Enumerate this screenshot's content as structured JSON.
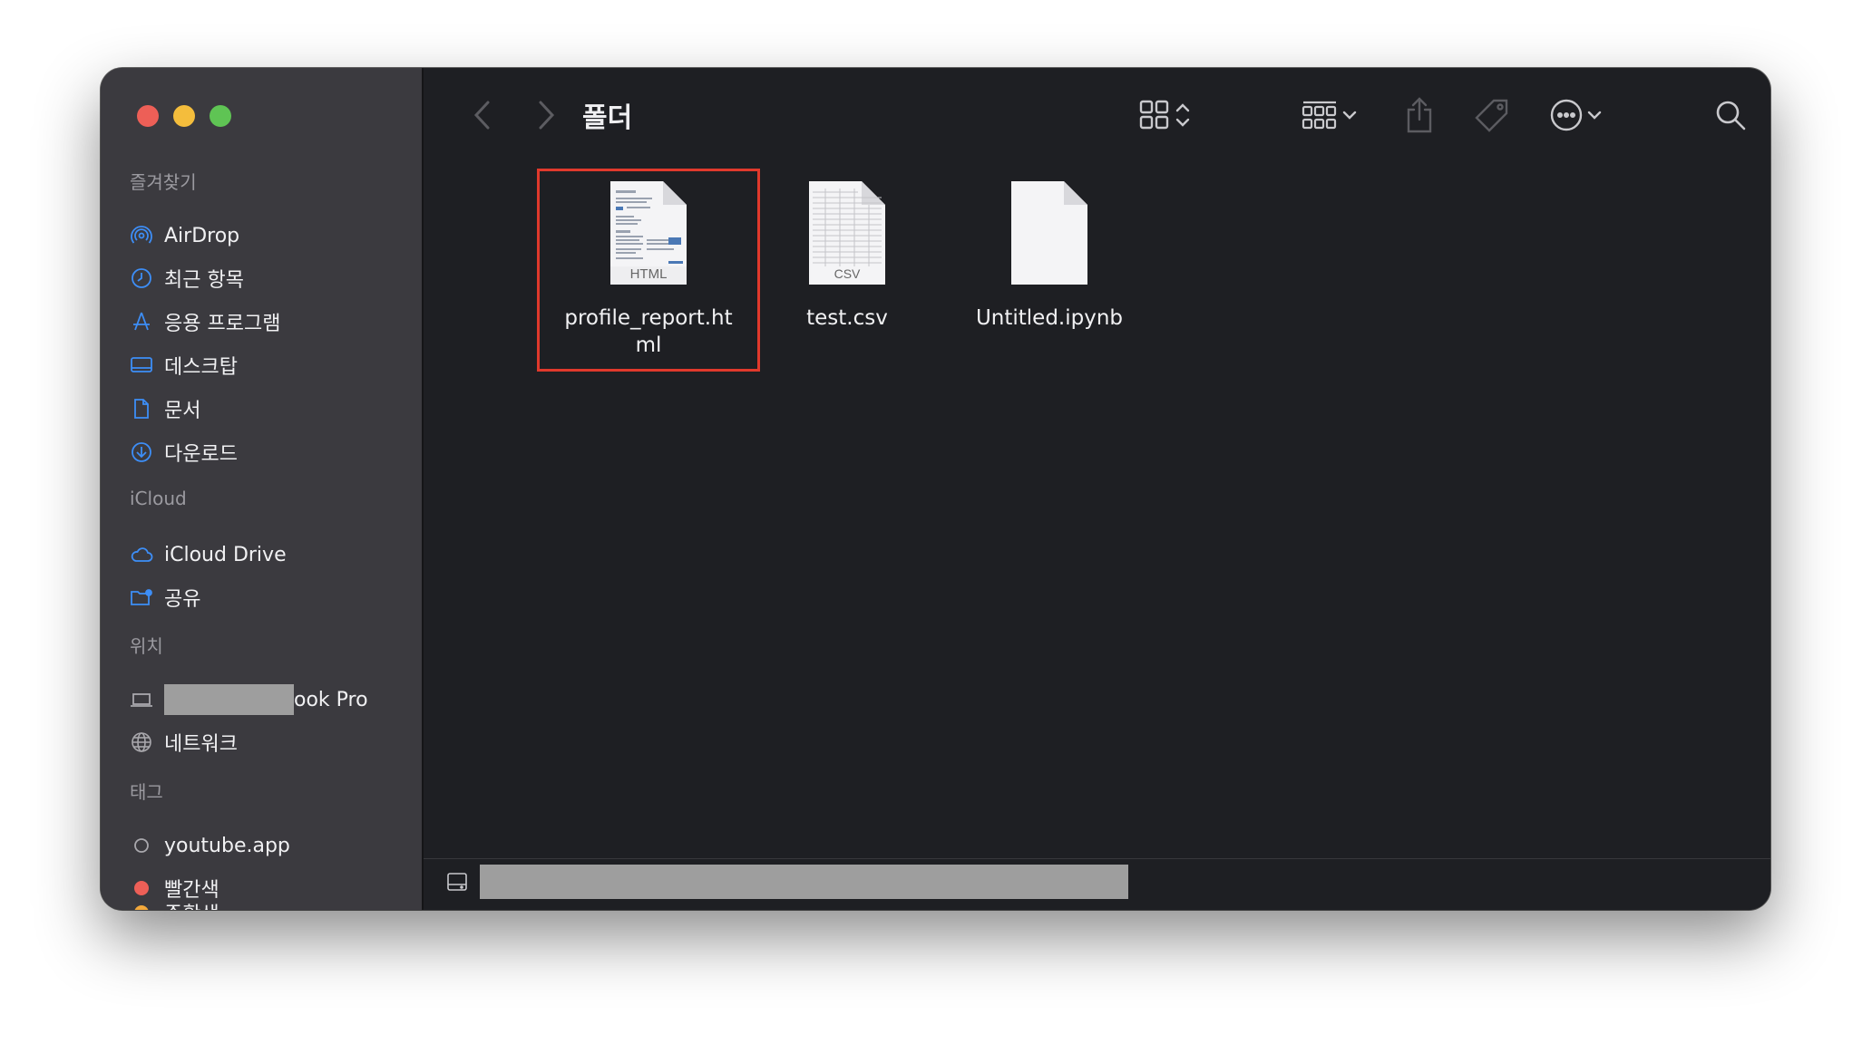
{
  "window": {
    "title": "폴더"
  },
  "sidebar": {
    "favorites_title": "즐겨찾기",
    "favorites": [
      {
        "label": "AirDrop",
        "icon": "airdrop-icon"
      },
      {
        "label": "최근 항목",
        "icon": "clock-icon"
      },
      {
        "label": "응용 프로그램",
        "icon": "apps-icon"
      },
      {
        "label": "데스크탑",
        "icon": "desktop-icon"
      },
      {
        "label": "문서",
        "icon": "document-icon"
      },
      {
        "label": "다운로드",
        "icon": "download-icon"
      }
    ],
    "icloud_title": "iCloud",
    "icloud": [
      {
        "label": "iCloud Drive",
        "icon": "cloud-icon"
      },
      {
        "label": "공유",
        "icon": "shared-folder-icon"
      }
    ],
    "locations_title": "위치",
    "locations": [
      {
        "label": "ook Pro",
        "icon": "laptop-icon"
      },
      {
        "label": "네트워크",
        "icon": "network-icon"
      }
    ],
    "tags_title": "태그",
    "tags": [
      {
        "label": "youtube.app",
        "color": "#000000"
      },
      {
        "label": "빨간색",
        "color": "#ed5f57"
      },
      {
        "label": "주황색",
        "color": "#f4a93c"
      }
    ]
  },
  "files": [
    {
      "name": "profile_report.html",
      "badge": "HTML",
      "selected": true
    },
    {
      "name": "test.csv",
      "badge": "CSV",
      "selected": false
    },
    {
      "name": "Untitled.ipynb",
      "badge": "",
      "selected": false
    }
  ],
  "colors": {
    "selection_outline": "#e0392c",
    "sidebar_icon": "#3d8ef7"
  }
}
